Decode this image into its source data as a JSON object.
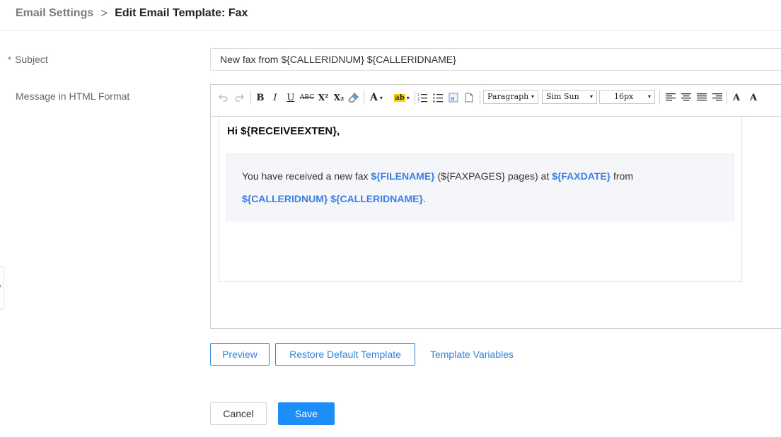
{
  "breadcrumb": {
    "parent": "Email Settings",
    "separator": ">",
    "current": "Edit Email Template: Fax"
  },
  "form": {
    "subject_label": "Subject",
    "required_mark": "*",
    "subject_value": "New fax from ${CALLERIDNUM} ${CALLERIDNAME}",
    "message_label": "Message in HTML Format"
  },
  "toolbar": {
    "undo_icon": "undo-icon",
    "redo_icon": "redo-icon",
    "bold": "B",
    "italic": "I",
    "underline": "U",
    "strike": "ABC",
    "superscript": "X²",
    "subscript": "X₂",
    "eraser_icon": "eraser-icon",
    "font_color": "A",
    "highlight": "ab",
    "ordered_list_icon": "ordered-list-icon",
    "unordered_list_icon": "unordered-list-icon",
    "image_icon": "image-icon",
    "page_icon": "page-icon",
    "block_format": "Paragraph",
    "font_family": "Sim Sun",
    "font_size": "16px",
    "dropdown_arrow": "▾",
    "align_icons": [
      "align-left-icon",
      "align-center-icon",
      "align-justify-icon",
      "align-right-icon"
    ],
    "text_a": "A"
  },
  "body": {
    "greeting": "Hi ${RECEIVEEXTEN},",
    "line1_pre": "You have received a new fax ",
    "filename_var": "${FILENAME}",
    "line1_mid": " (${FAXPAGES} pages) at ",
    "faxdate_var": "${FAXDATE}",
    "line1_post": " from",
    "callerid_var": "${CALLERIDNUM} ${CALLERIDNAME}",
    "line2_post": "."
  },
  "actions": {
    "preview": "Preview",
    "restore": "Restore Default Template",
    "variables": "Template Variables",
    "cancel": "Cancel",
    "save": "Save"
  },
  "colors": {
    "accent": "#2f86d6",
    "primary": "#1c8ef9",
    "variable": "#3a7ee6",
    "required": "#e4393c"
  }
}
